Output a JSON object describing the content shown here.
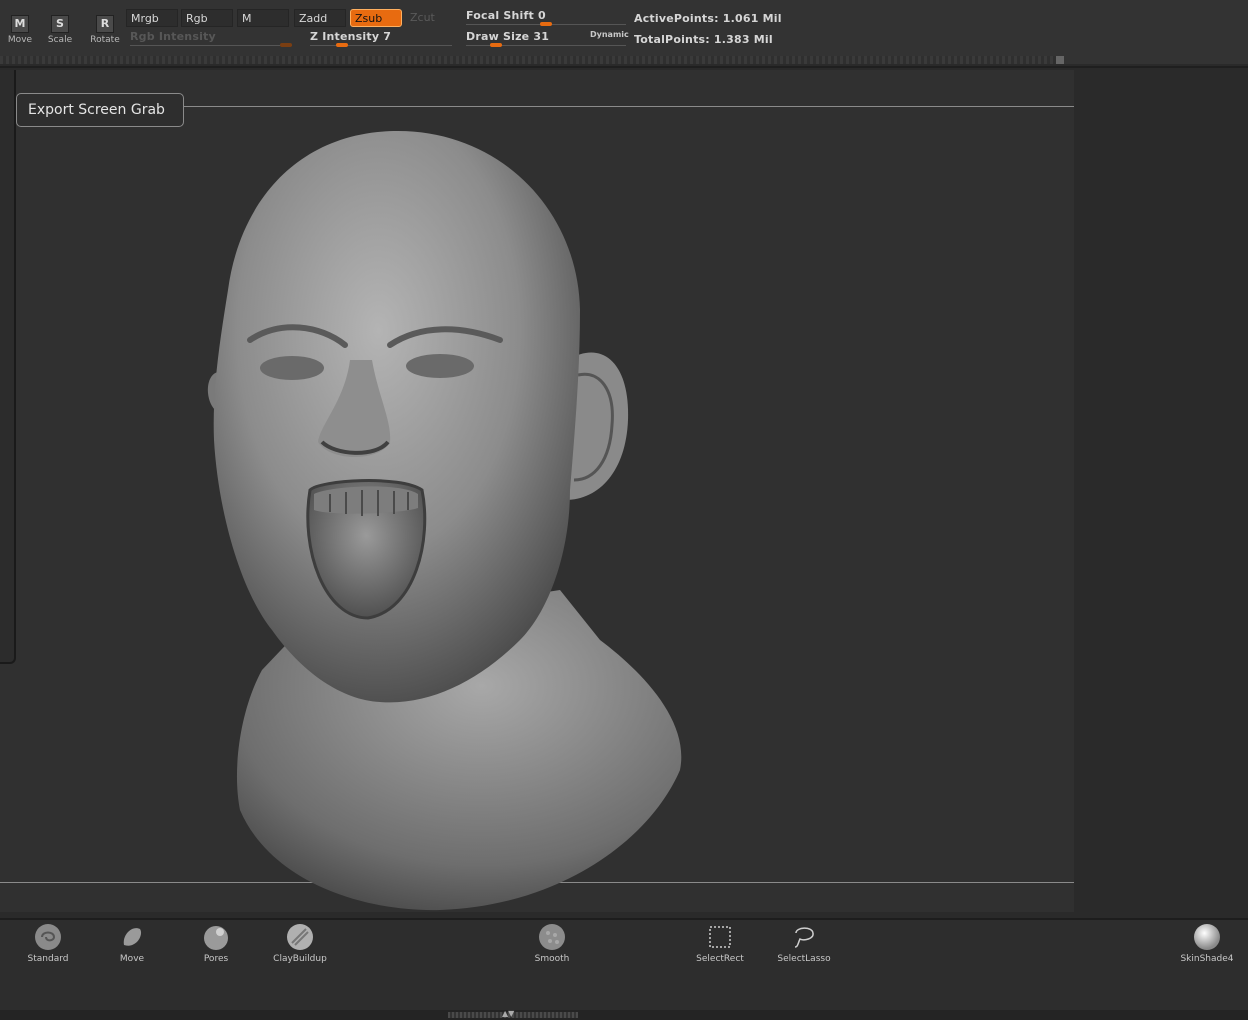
{
  "transform_tools": [
    {
      "key": "M",
      "label": "Move"
    },
    {
      "key": "S",
      "label": "Scale"
    },
    {
      "key": "R",
      "label": "Rotate"
    }
  ],
  "modes": {
    "mrgb": "Mrgb",
    "rgb": "Rgb",
    "m": "M",
    "zadd": "Zadd",
    "zsub": "Zsub",
    "zcut": "Zcut"
  },
  "sliders": {
    "rgb_intensity": {
      "label": "Rgb  Intensity",
      "value": "",
      "enabled": false
    },
    "z_intensity": {
      "label": "Z  Intensity",
      "value": "7"
    },
    "focal_shift": {
      "label": "Focal  Shift",
      "value": "0"
    },
    "draw_size": {
      "label": "Draw  Size",
      "value": "31"
    },
    "dynamic_label": "Dynamic"
  },
  "stats": {
    "active_points": "ActivePoints: 1.061  Mil",
    "total_points": "TotalPoints: 1.383  Mil"
  },
  "canvas": {
    "export_button": "Export Screen Grab"
  },
  "shelf": {
    "brushes": [
      "Standard",
      "Move",
      "Pores",
      "ClayBuildup",
      "Smooth"
    ],
    "selection": [
      "SelectRect",
      "SelectLasso"
    ],
    "material": "SkinShade4"
  },
  "colors": {
    "accent": "#e86b10",
    "panel": "#333333",
    "canvas": "#303030"
  }
}
